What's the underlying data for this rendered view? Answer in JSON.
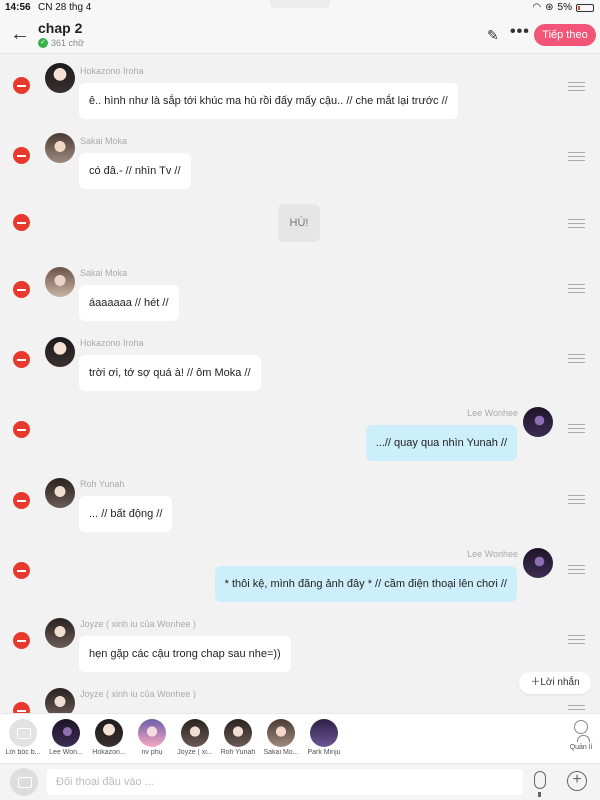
{
  "status_bar": {
    "time": "14:56",
    "date": "CN 28 thg 4",
    "battery": "5%"
  },
  "header": {
    "title": "chap 2",
    "word_count": "361 chữ",
    "next_label": "Tiếp theo"
  },
  "messages": [
    {
      "name": "Hokazono Iroha",
      "text": "ê.. hình như là sắp tới khúc ma hù rồi đấy mấy cậu.. // che mắt lại trước //"
    },
    {
      "name": "Sakai Moka",
      "text": "có đâ.- // nhìn Tv //"
    },
    {
      "name": "",
      "text": "HÙ!"
    },
    {
      "name": "Sakai Moka",
      "text": "áaaaaaa // hét //"
    },
    {
      "name": "Hokazono Iroha",
      "text": "trời ơi, tớ sợ quá à! // ôm Moka //"
    },
    {
      "name": "Lee Wonhee",
      "text": "...// quay qua nhìn Yunah //"
    },
    {
      "name": "Roh Yunah",
      "text": "... // bất động //"
    },
    {
      "name": "Lee Wonhee",
      "text": "* thôi kệ, mình đăng ảnh đây * // cầm điện thoại lên chơi //"
    },
    {
      "name": "Joyze ( xinh iu của Wonhee )",
      "text": "hẹn gặp các cậu trong chap sau nhe=))"
    },
    {
      "name": "Joyze ( xinh iu của Wonhee )",
      "text": ""
    }
  ],
  "add_message_label": "Lời nhắn",
  "characters": [
    {
      "label": "Lời bốc b..."
    },
    {
      "label": "Lee Won..."
    },
    {
      "label": "Hokazon..."
    },
    {
      "label": "nv phụ"
    },
    {
      "label": "Joyze ( xi..."
    },
    {
      "label": "Roh Yunah"
    },
    {
      "label": "Sakai Mo..."
    },
    {
      "label": "Park Minju"
    }
  ],
  "manage_label": "Quản lí",
  "input": {
    "placeholder": "Đối thoại đầu vào ..."
  },
  "colors": {
    "accent": "#f25577",
    "delete": "#e8392f",
    "right_bubble": "#cdeefb"
  }
}
